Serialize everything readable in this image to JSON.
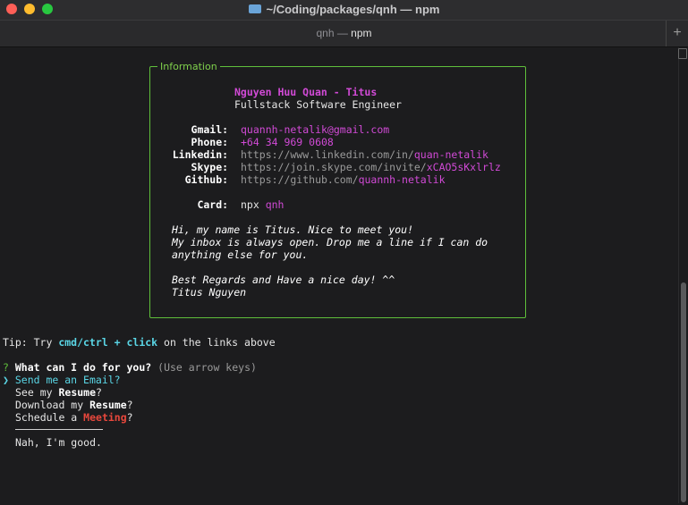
{
  "window": {
    "title": "~/Coding/packages/qnh — npm",
    "tab_prefix": "qnh — ",
    "tab_strong": "npm",
    "new_tab": "+"
  },
  "card": {
    "box_title": "Information",
    "name": "Nguyen Huu Quan - Titus",
    "role": "Fullstack Software Engineer",
    "rows": [
      {
        "label": "Gmail:",
        "plain": "",
        "highlight": "quannh-netalik@gmail.com"
      },
      {
        "label": "Phone:",
        "plain": "",
        "highlight": "+64 34 969 0608"
      },
      {
        "label": "Linkedin:",
        "plain": "https://www.linkedin.com/in/",
        "highlight": "quan-netalik"
      },
      {
        "label": "Skype:",
        "plain": "https://join.skype.com/invite/",
        "highlight": "xCAO5sKxlrlz"
      },
      {
        "label": "Github:",
        "plain": "https://github.com/",
        "highlight": "quannh-netalik"
      },
      {
        "label": "Card:",
        "plain": "npx ",
        "highlight": "qnh"
      }
    ],
    "message": [
      "Hi, my name is Titus. Nice to meet you!",
      "My inbox is always open. Drop me a line if I can do",
      "anything else for you.",
      "",
      "Best Regards and Have a nice day! ^^",
      "Titus Nguyen"
    ]
  },
  "tip": {
    "prefix": "Tip: Try ",
    "keys": "cmd/ctrl + click",
    "suffix": " on the links above"
  },
  "prompt": {
    "qmark": "?",
    "question": "What can I do for you?",
    "hint": "(Use arrow keys)",
    "pointer": "❯",
    "options": [
      {
        "pre": "Send me an ",
        "em": "Email",
        "post": "?",
        "em_style": "cyan"
      },
      {
        "pre": "See my ",
        "em": "Resume",
        "post": "?",
        "em_style": "bold"
      },
      {
        "pre": "Download my ",
        "em": "Resume",
        "post": "?",
        "em_style": "bold"
      },
      {
        "pre": "Schedule a ",
        "em": "Meeting",
        "post": "?",
        "em_style": "red"
      }
    ],
    "last_option": "Nah, I'm good."
  }
}
